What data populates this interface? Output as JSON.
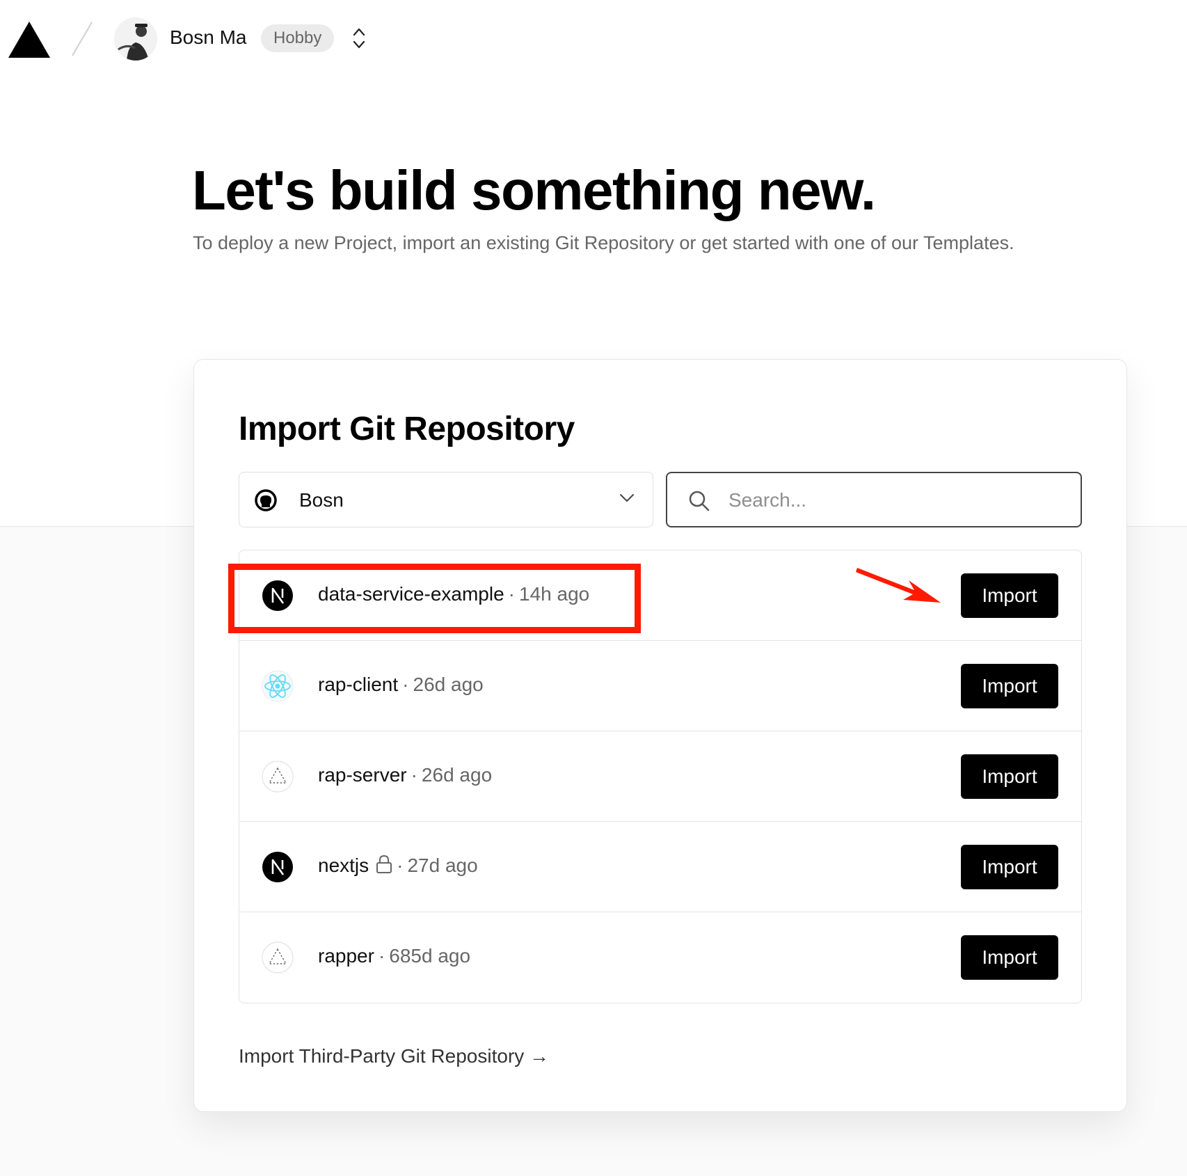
{
  "header": {
    "username": "Bosn Ma",
    "plan": "Hobby",
    "icons": [
      "vercel-logo-icon",
      "avatar",
      "switch-scope-icon"
    ]
  },
  "hero": {
    "title": "Let's build something new.",
    "subtitle": "To deploy a new Project, import an existing Git Repository or get started with one of our Templates."
  },
  "import_card": {
    "title": "Import Git Repository",
    "scope_select": {
      "value": "Bosn",
      "icon": "github-icon"
    },
    "search": {
      "placeholder": "Search...",
      "value": ""
    },
    "repos": [
      {
        "name": "data-service-example",
        "separator": "·",
        "time": "14h ago",
        "icon": "nextjs-icon",
        "private": false,
        "button": "Import"
      },
      {
        "name": "rap-client",
        "separator": "·",
        "time": "26d ago",
        "icon": "react-icon",
        "private": false,
        "button": "Import"
      },
      {
        "name": "rap-server",
        "separator": "·",
        "time": "26d ago",
        "icon": "vercel-outline-icon",
        "private": false,
        "button": "Import"
      },
      {
        "name": "nextjs",
        "separator": "·",
        "time": "27d ago",
        "icon": "nextjs-icon",
        "private": true,
        "button": "Import"
      },
      {
        "name": "rapper",
        "separator": "·",
        "time": "685d ago",
        "icon": "vercel-outline-icon",
        "private": false,
        "button": "Import"
      }
    ],
    "third_party_link": "Import Third-Party Git Repository →"
  },
  "annotations": {
    "highlight_color": "#ff1a00",
    "arrow_color": "#ff1a00"
  }
}
